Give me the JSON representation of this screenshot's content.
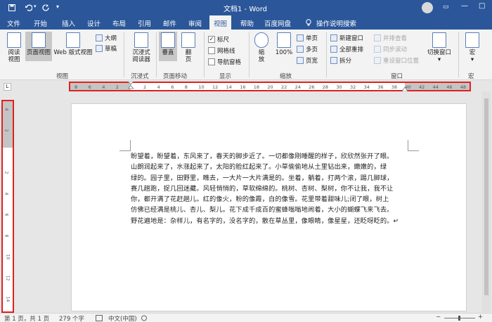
{
  "app": {
    "window_title": "文档1 - Word"
  },
  "titlebar": {
    "icons": [
      "save-icon",
      "undo-icon",
      "redo-icon",
      "qat-dropdown-icon"
    ],
    "controls": [
      "ribbon-display-icon",
      "minimize-icon",
      "maximize-icon",
      "close-icon"
    ]
  },
  "tabs": [
    "文件",
    "开始",
    "插入",
    "设计",
    "布局",
    "引用",
    "邮件",
    "审阅",
    "视图",
    "帮助",
    "百度网盘"
  ],
  "active_tab": "视图",
  "tell_me": "操作说明搜索",
  "ribbon": {
    "views": {
      "read_mode": "阅读\n视图",
      "print_layout": "页面视图",
      "web_layout": "Web 版式视图",
      "outline": "大纲",
      "draft": "草稿",
      "group": "视图"
    },
    "immersive": {
      "reader": "沉浸式\n阅读器",
      "group": "沉浸式"
    },
    "page_movement": {
      "vertical": "垂直",
      "side_to_side": "翻\n页",
      "group": "页面移动"
    },
    "show": {
      "ruler": "标尺",
      "gridlines": "网格线",
      "nav_pane": "导航窗格",
      "group": "显示",
      "ruler_checked": true,
      "gridlines_checked": false,
      "nav_checked": false
    },
    "zoom": {
      "zoom": "缩\n放",
      "percent": "100%",
      "one_page": "单页",
      "multi_page": "多页",
      "page_width": "页宽",
      "group": "缩放"
    },
    "window": {
      "new_window": "新建窗口",
      "arrange_all": "全部重排",
      "split": "拆分",
      "side_by_side": "并排查看",
      "sync_scroll": "同步滚动",
      "reset_pos": "重设窗口位置",
      "switch_windows": "切换窗口",
      "group": "窗口"
    },
    "macros": {
      "macros": "宏",
      "group": "宏"
    }
  },
  "ruler_h_numbers": [
    "8",
    "6",
    "4",
    "2",
    "",
    "2",
    "4",
    "6",
    "8",
    "10",
    "12",
    "14",
    "16",
    "18",
    "20",
    "22",
    "24",
    "26",
    "28",
    "30",
    "32",
    "34",
    "36",
    "38",
    "40",
    "42",
    "44",
    "46",
    "48"
  ],
  "ruler_v_numbers": [
    "4",
    "2",
    "",
    "2",
    "4",
    "6",
    "8",
    "10",
    "12",
    "14"
  ],
  "document": {
    "lines": [
      "盼望着，盼望着，东风来了，春天的脚步近了。一切都像刚睡醒的样子，欣欣然张开了眼。",
      "山朗润起来了，水涨起来了，太阳的脸红起来了。小草偷偷地从土里钻出来，嫩嫩的，绿",
      "绿的。园子里，田野里，瞧去，一大片一大片满是的。坐着，躺着，打两个滚，踢几脚球，",
      "赛几趟跑，捉几回迷藏。风轻悄悄的，草软绵绵的。桃树、杏树、梨树，你不让我，我不让",
      "你，都开满了花赶趟儿。红的像火，粉的像霞，白的像雪。花里带着甜味儿;闭了眼，树上",
      "仿佛已经满是桃儿、杏儿、梨儿。花下成千成百的蜜蜂嗡嗡地闹着，大小的蝴蝶飞来飞去。",
      "野花遍地是：杂样儿，有名字的，没名字的，散在草丛里，像眼睛，像星星，还眨呀眨的。↵"
    ]
  },
  "status": {
    "page": "第 1 页，共 1 页",
    "words": "279 个字",
    "lang": "中文(中国)"
  },
  "colors": {
    "brand": "#2b579a",
    "highlight": "#e02020"
  }
}
